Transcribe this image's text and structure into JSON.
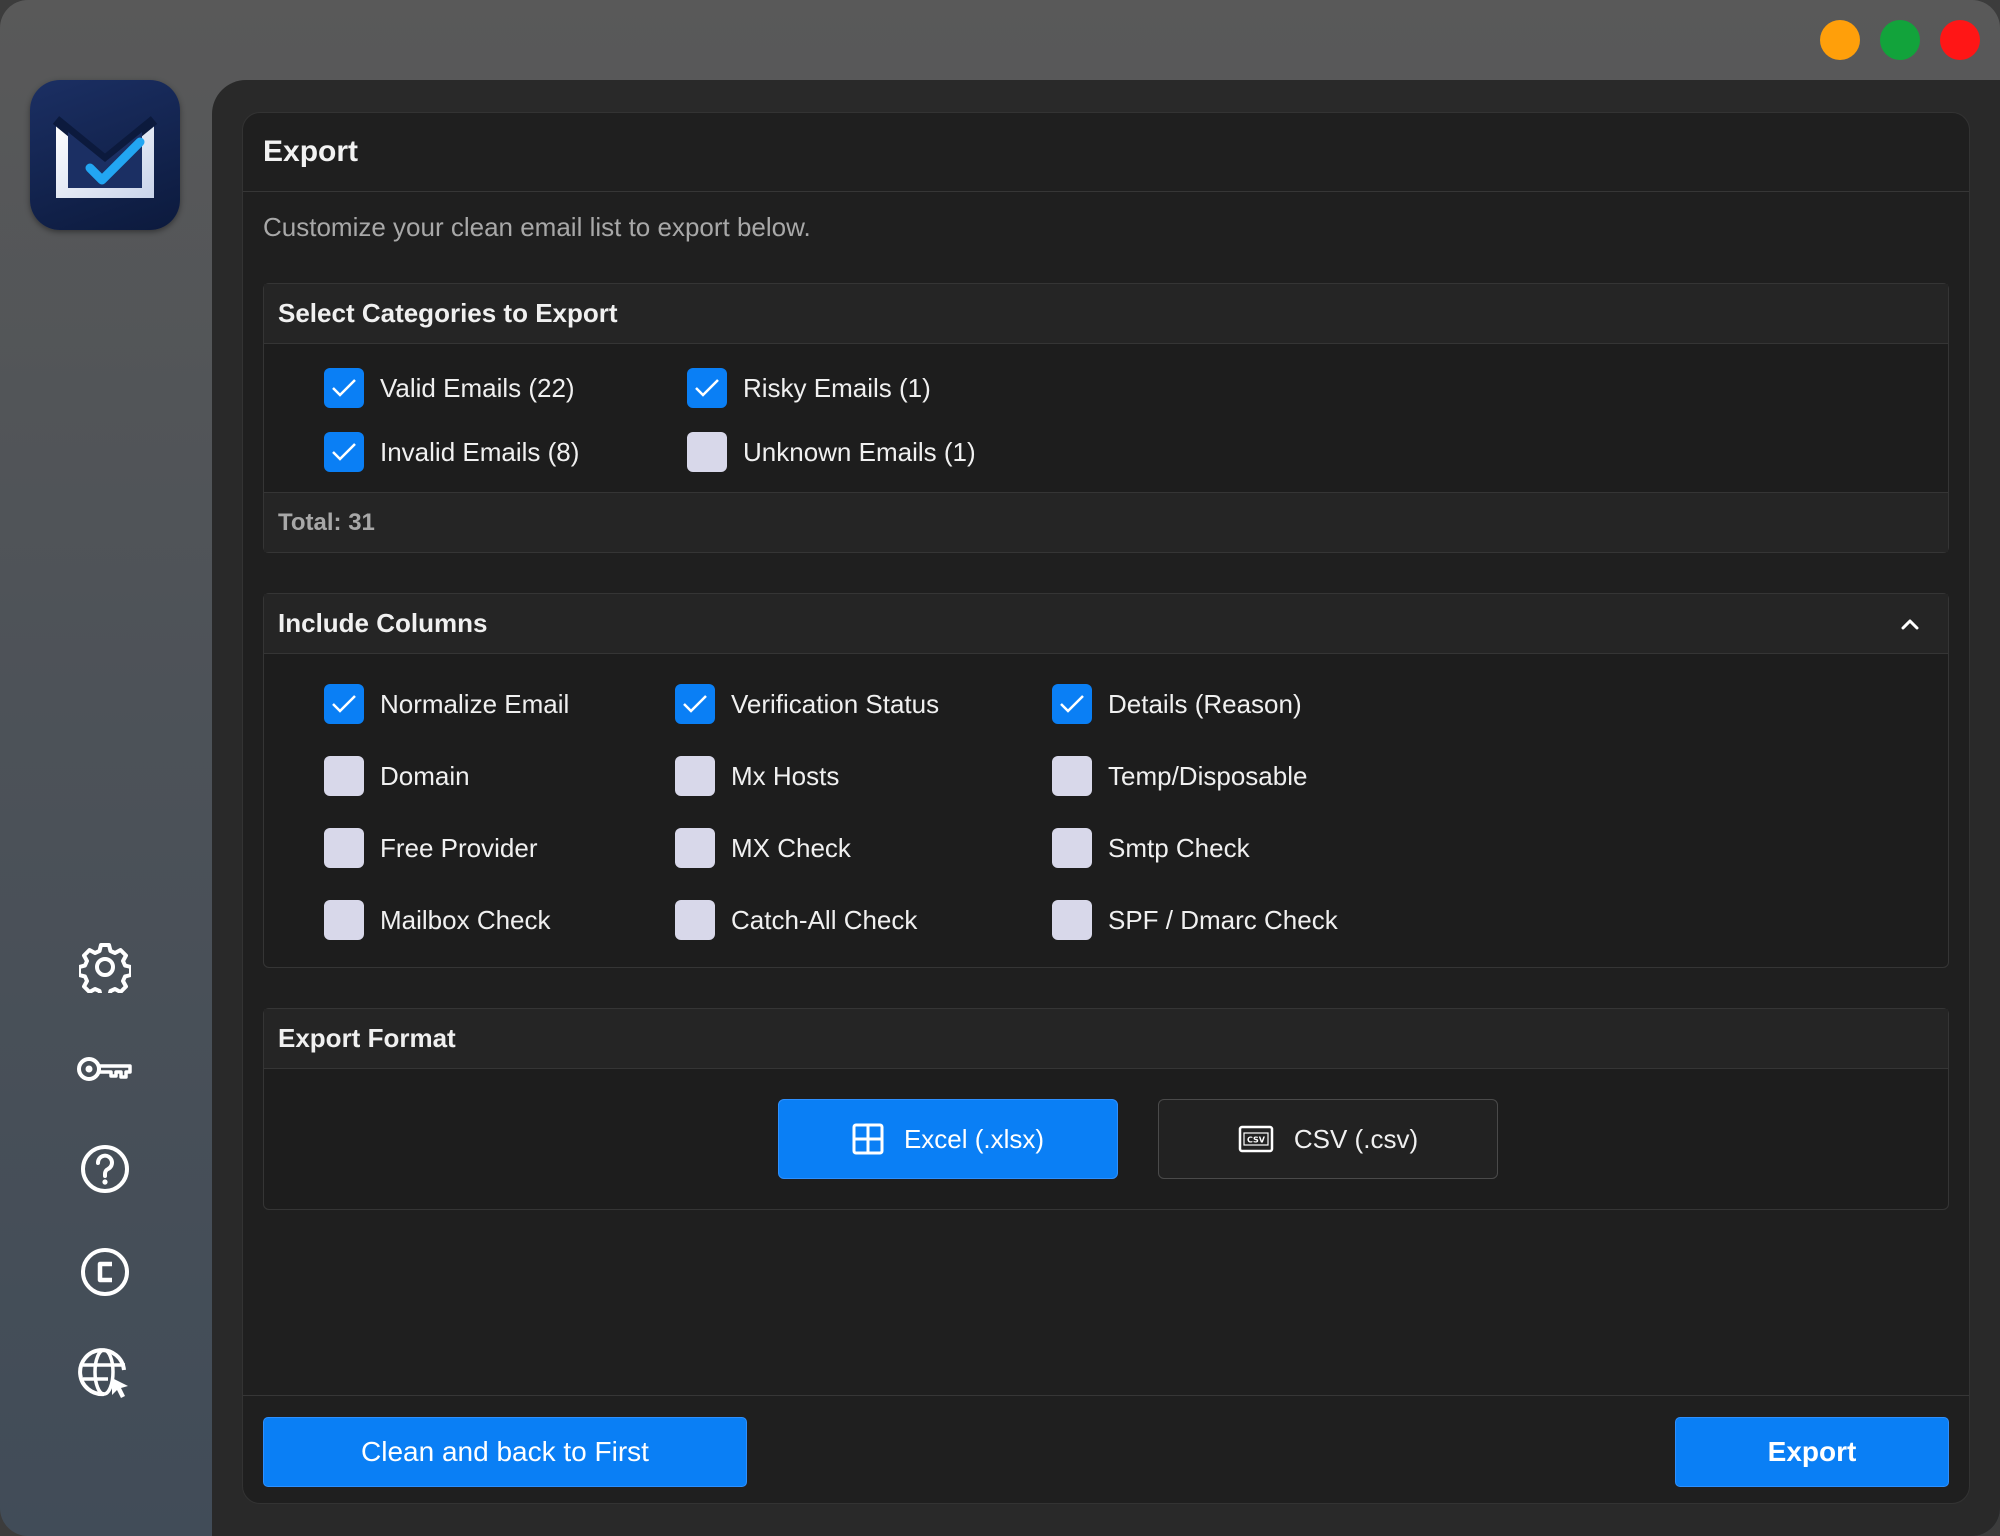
{
  "window": {
    "controls": [
      "minimize",
      "zoom",
      "close"
    ],
    "colors": {
      "orange": "#ff9f0a",
      "green": "#12a33b",
      "red": "#ff1616"
    }
  },
  "sidebar": {
    "logo_icon": "mail-check-icon",
    "icons": [
      "gear-icon",
      "key-icon",
      "help-icon",
      "copyright-icon",
      "globe-cursor-icon"
    ]
  },
  "page": {
    "title": "Export",
    "subtitle": "Customize your clean email list to export below."
  },
  "categories": {
    "title": "Select Categories to Export",
    "items": [
      {
        "label": "Valid Emails (22)",
        "checked": true
      },
      {
        "label": "Risky Emails (1)",
        "checked": true
      },
      {
        "label": "Invalid Emails (8)",
        "checked": true
      },
      {
        "label": "Unknown Emails (1)",
        "checked": false
      }
    ],
    "total": "Total: 31"
  },
  "columns": {
    "title": "Include Columns",
    "items": [
      {
        "label": "Normalize Email",
        "checked": true
      },
      {
        "label": "Verification Status",
        "checked": true
      },
      {
        "label": "Details (Reason)",
        "checked": true
      },
      {
        "label": "Domain",
        "checked": false
      },
      {
        "label": "Mx Hosts",
        "checked": false
      },
      {
        "label": "Temp/Disposable",
        "checked": false
      },
      {
        "label": "Free Provider",
        "checked": false
      },
      {
        "label": "MX Check",
        "checked": false
      },
      {
        "label": "Smtp Check",
        "checked": false
      },
      {
        "label": "Mailbox Check",
        "checked": false
      },
      {
        "label": "Catch-All Check",
        "checked": false
      },
      {
        "label": "SPF / Dmarc Check",
        "checked": false
      }
    ]
  },
  "format": {
    "title": "Export Format",
    "options": [
      {
        "label": "Excel (.xlsx)",
        "icon": "grid-icon",
        "selected": true
      },
      {
        "label": "CSV (.csv)",
        "icon": "csv-file-icon",
        "selected": false
      }
    ]
  },
  "actions": {
    "clean_label": "Clean and back to First",
    "export_label": "Export"
  },
  "colors": {
    "accent": "#0a7ff5",
    "card_bg": "#1f1f1f",
    "checkbox_off": "#d8d8ea"
  }
}
